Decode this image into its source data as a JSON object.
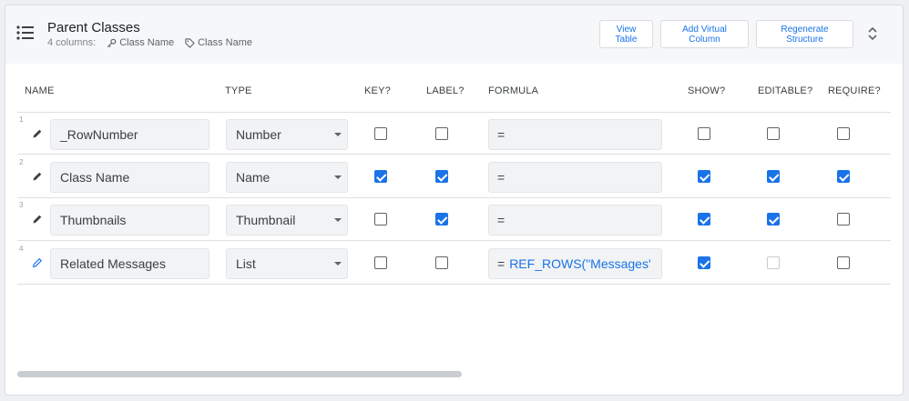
{
  "header": {
    "title": "Parent Classes",
    "columns_count": "4 columns:",
    "key_column": "Class Name",
    "label_column": "Class Name",
    "buttons": {
      "view_table": "View Table",
      "add_virtual_column": "Add Virtual Column",
      "regenerate_structure": "Regenerate Structure"
    }
  },
  "columns": {
    "name": "NAME",
    "type": "TYPE",
    "key": "KEY?",
    "label": "LABEL?",
    "formula": "FORMULA",
    "show": "SHOW?",
    "editable": "EDITABLE?",
    "require": "REQUIRE?"
  },
  "rows": [
    {
      "num": "1",
      "name": "_RowNumber",
      "type": "Number",
      "formula_eq": "=",
      "formula_expr": "",
      "key": false,
      "label": false,
      "show": false,
      "editable": false,
      "require": false
    },
    {
      "num": "2",
      "name": "Class Name",
      "type": "Name",
      "formula_eq": "=",
      "formula_expr": "",
      "key": true,
      "label": true,
      "show": true,
      "editable": true,
      "require": true
    },
    {
      "num": "3",
      "name": "Thumbnails",
      "type": "Thumbnail",
      "formula_eq": "=",
      "formula_expr": "",
      "key": false,
      "label": true,
      "show": true,
      "editable": true,
      "require": false
    },
    {
      "num": "4",
      "name": "Related Messages",
      "type": "List",
      "formula_eq": "=",
      "formula_expr": "REF_ROWS(\"Messages'",
      "key": false,
      "label": false,
      "show": true,
      "editable": false,
      "editable_disabled": true,
      "require": false
    }
  ],
  "colors": {
    "accent": "#1a73e8",
    "header_bg": "#f6f7f9",
    "field_bg": "#f1f3f4"
  },
  "icons": {
    "menu": "list-icon",
    "edit": "pencil-icon",
    "key": "key-icon",
    "label": "tag-icon",
    "expand": "unfold-icon"
  }
}
